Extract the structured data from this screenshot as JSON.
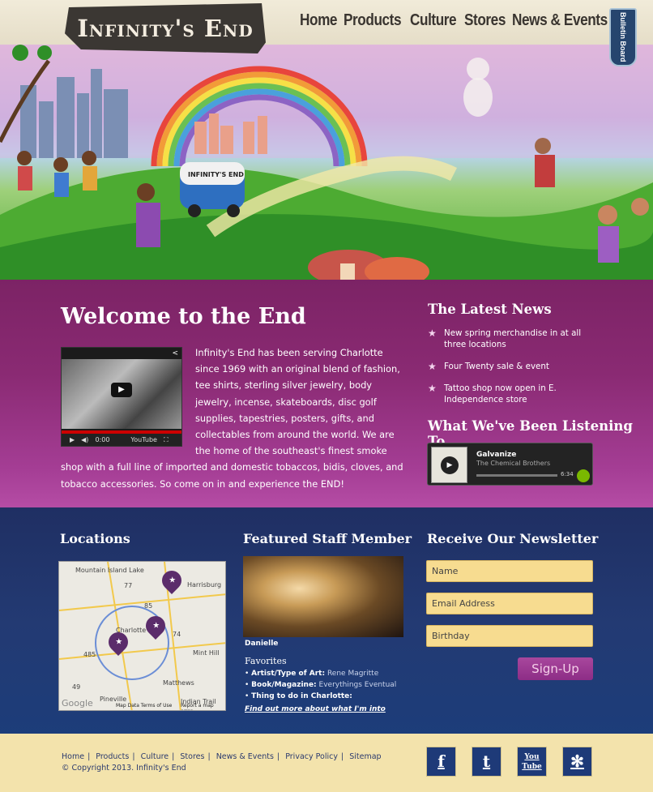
{
  "header": {
    "logo": "Infinity's End",
    "nav": [
      "Home",
      "Products",
      "Culture",
      "Stores",
      "News & Events"
    ],
    "bulletin_tag": "Bulletin Board"
  },
  "hero": {
    "van_text": "INFINITY'S END"
  },
  "welcome": {
    "title": "Welcome to the End",
    "body": "Infinity's End has been serving Charlotte since 1969 with an original blend of fashion, tee shirts, sterling silver jewelry, body jewelry, incense, skateboards, disc golf supplies, tapestries, posters, gifts, and collectables from around the world. We are the home of the southeast's finest smoke shop with a full line of imported and domestic tobaccos, bidis, cloves, and tobacco accessories. So come on in and experience the END!",
    "video": {
      "time": "0:00",
      "brand": "YouTube"
    }
  },
  "news": {
    "title": "The Latest News",
    "items": [
      "New spring merchandise in at all three locations",
      "Four Twenty sale & event",
      "Tattoo shop now open in E. Independence store"
    ]
  },
  "listening": {
    "title": "What We've Been Listening To",
    "song": "Galvanize",
    "artist": "The Chemical Brothers",
    "duration": "6:34"
  },
  "locations": {
    "title": "Locations",
    "map_labels": [
      "Mountain Island Lake",
      "Harrisburg",
      "Charlotte",
      "Mint Hill",
      "Matthews",
      "Pineville",
      "Indian Trail"
    ],
    "road_labels": [
      "77",
      "85",
      "485",
      "74",
      "49"
    ],
    "map_footer": "Map Data  Terms of Use",
    "report": "Report a map error",
    "google": "Google"
  },
  "staff": {
    "title": "Featured Staff Member",
    "name": "Danielle",
    "favorites_title": "Favorites",
    "favorites": [
      {
        "label": "Artist/Type of Art:",
        "value": "Rene Magritte"
      },
      {
        "label": "Book/Magazine:",
        "value": "Everythings Eventual"
      },
      {
        "label": "Thing to do in Charlotte:",
        "value": ""
      }
    ],
    "more_link": "Find out more about what I'm into"
  },
  "newsletter": {
    "title": "Receive Our Newsletter",
    "fields": [
      "Name",
      "Email Address",
      "Birthday"
    ],
    "button": "Sign-Up"
  },
  "footer": {
    "links": [
      "Home",
      "Products",
      "Culture",
      "Stores",
      "News & Events",
      "Privacy Policy",
      "Sitemap"
    ],
    "copyright": "© Copyright 2013. Infinity's End",
    "social": {
      "facebook": "f",
      "twitter": "t",
      "youtube": "You Tube",
      "yelp": "✻"
    }
  }
}
